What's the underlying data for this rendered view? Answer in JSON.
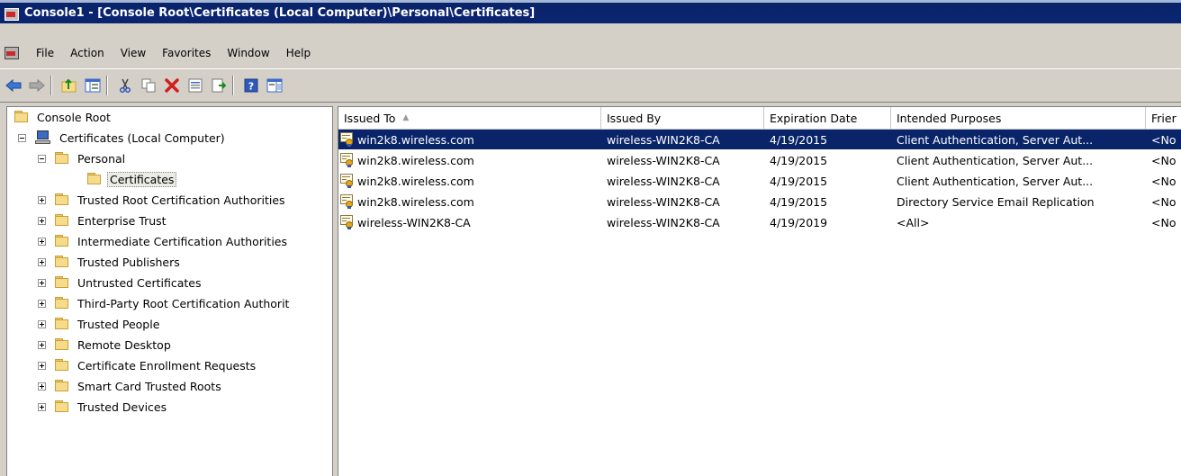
{
  "window": {
    "title": "Console1 - [Console Root\\Certificates (Local Computer)\\Personal\\Certificates]"
  },
  "menu": [
    "File",
    "Action",
    "View",
    "Favorites",
    "Window",
    "Help"
  ],
  "toolbar": {
    "buttons": [
      "back-icon",
      "forward-icon",
      "up-folder-icon",
      "show-hide-tree-icon",
      "cut-icon",
      "copy-icon",
      "delete-icon",
      "properties-icon",
      "export-list-icon",
      "help-icon",
      "show-action-pane-icon"
    ]
  },
  "tree": {
    "root": "Console Root",
    "computer": "Certificates (Local Computer)",
    "personal": "Personal",
    "certificates": "Certificates",
    "stores": [
      "Trusted Root Certification Authorities",
      "Enterprise Trust",
      "Intermediate Certification Authorities",
      "Trusted Publishers",
      "Untrusted Certificates",
      "Third-Party Root Certification Authorit",
      "Trusted People",
      "Remote Desktop",
      "Certificate Enrollment Requests",
      "Smart Card Trusted Roots",
      "Trusted Devices"
    ]
  },
  "list": {
    "columns": [
      "Issued To",
      "Issued By",
      "Expiration Date",
      "Intended Purposes",
      "Frier"
    ],
    "sort_indicator": "▲",
    "rows": [
      {
        "issued_to": "win2k8.wireless.com",
        "issued_by": "wireless-WIN2K8-CA",
        "expiration": "4/19/2015",
        "purposes": "Client Authentication, Server Aut...",
        "friendly": "<No"
      },
      {
        "issued_to": "win2k8.wireless.com",
        "issued_by": "wireless-WIN2K8-CA",
        "expiration": "4/19/2015",
        "purposes": "Client Authentication, Server Aut...",
        "friendly": "<No"
      },
      {
        "issued_to": "win2k8.wireless.com",
        "issued_by": "wireless-WIN2K8-CA",
        "expiration": "4/19/2015",
        "purposes": "Client Authentication, Server Aut...",
        "friendly": "<No"
      },
      {
        "issued_to": "win2k8.wireless.com",
        "issued_by": "wireless-WIN2K8-CA",
        "expiration": "4/19/2015",
        "purposes": "Directory Service Email Replication",
        "friendly": "<No"
      },
      {
        "issued_to": "wireless-WIN2K8-CA",
        "issued_by": "wireless-WIN2K8-CA",
        "expiration": "4/19/2019",
        "purposes": "<All>",
        "friendly": "<No"
      }
    ],
    "selected_row": 0
  },
  "colors": {
    "title_bar": "#0a246a",
    "selection": "#0a246a",
    "chrome": "#d4d0c8"
  }
}
